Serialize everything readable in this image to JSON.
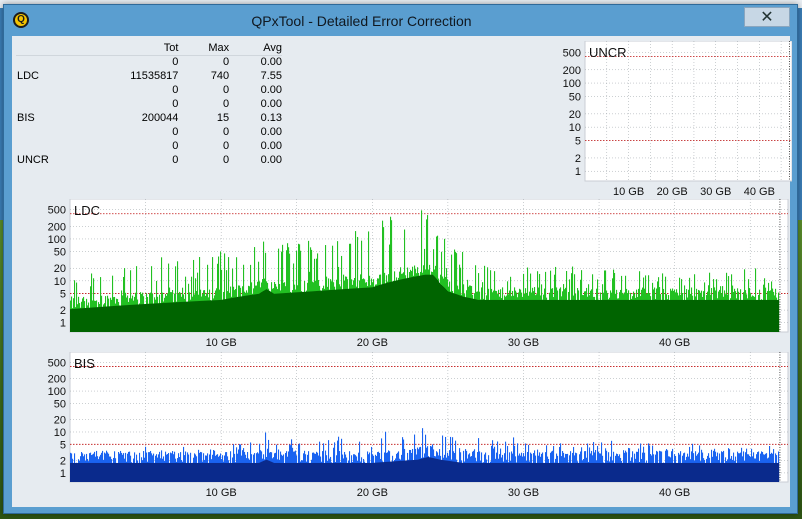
{
  "window": {
    "title": "QPxTool - Detailed Error Correction",
    "close_glyph": "✕",
    "app_icon_letter": "Q"
  },
  "colors": {
    "window_frame": "#5a9ed0",
    "client_bg": "#e6ebf0",
    "plot_bg": "#ffffff",
    "ldc_dark": "#006400",
    "ldc_light": "#22c022",
    "bis_dark": "#0a2a8c",
    "bis_light": "#1a63f0",
    "limit_line": "#c01010",
    "grid": "#9aa0a6"
  },
  "stats": {
    "headers": [
      "",
      "Tot",
      "Max",
      "Avg"
    ],
    "rows": [
      [
        "",
        "0",
        "0",
        "0.00"
      ],
      [
        "LDC",
        "11535817",
        "740",
        "7.55"
      ],
      [
        "",
        "0",
        "0",
        "0.00"
      ],
      [
        "",
        "0",
        "0",
        "0.00"
      ],
      [
        "BIS",
        "200044",
        "15",
        "0.13"
      ],
      [
        "",
        "0",
        "0",
        "0.00"
      ],
      [
        "",
        "0",
        "0",
        "0.00"
      ],
      [
        "UNCR",
        "0",
        "0",
        "0.00"
      ]
    ]
  },
  "chart_data": [
    {
      "type": "bar",
      "title": "UNCR",
      "y_scale": "log",
      "yticks": [
        "500",
        "200",
        "100",
        "50",
        "20",
        "10",
        "5",
        "2",
        "1"
      ],
      "xticks": [
        "10 GB",
        "20 GB",
        "30 GB",
        "40 GB"
      ],
      "xlim": [
        0,
        47.5
      ],
      "limit_lines": [
        400,
        5
      ],
      "grid": true,
      "series": [
        {
          "values": []
        }
      ]
    },
    {
      "type": "bar",
      "title": "LDC",
      "y_scale": "log",
      "yticks": [
        "500",
        "200",
        "100",
        "50",
        "20",
        "10",
        "5",
        "2",
        "1"
      ],
      "xticks": [
        "10 GB",
        "20 GB",
        "30 GB",
        "40 GB"
      ],
      "xlim": [
        0,
        47.5
      ],
      "data_end": 46.9,
      "limit_lines": [
        400,
        5
      ],
      "grid": true,
      "max_value": 740,
      "avg_value": 7.55,
      "profile": {
        "x": [
          0,
          5,
          10,
          12.5,
          13,
          13.5,
          16,
          20,
          23.5,
          24,
          24.5,
          25,
          26,
          27,
          28,
          30,
          35,
          40,
          46.9
        ],
        "upper": [
          15,
          25,
          40,
          70,
          160,
          70,
          90,
          150,
          500,
          300,
          110,
          60,
          40,
          30,
          22,
          18,
          18,
          16,
          16
        ],
        "typical": [
          3,
          4,
          5,
          7,
          9,
          7,
          8,
          10,
          20,
          20,
          12,
          8,
          6,
          5,
          5,
          5,
          5,
          5,
          5
        ]
      }
    },
    {
      "type": "bar",
      "title": "BIS",
      "y_scale": "log",
      "yticks": [
        "500",
        "200",
        "100",
        "50",
        "20",
        "10",
        "5",
        "2",
        "1"
      ],
      "xticks": [
        "10 GB",
        "20 GB",
        "30 GB",
        "40 GB"
      ],
      "xlim": [
        0,
        47.5
      ],
      "data_end": 46.9,
      "limit_lines": [
        400,
        5
      ],
      "grid": true,
      "max_value": 15,
      "avg_value": 0.13,
      "profile": {
        "x": [
          0,
          10,
          12.5,
          13,
          13.5,
          16,
          20,
          23,
          23.7,
          24.5,
          26,
          28,
          35,
          46.9
        ],
        "upper": [
          3,
          4,
          6,
          12,
          5,
          6,
          8,
          10,
          15,
          9,
          7,
          6,
          5,
          4
        ],
        "typical": [
          2.5,
          2.5,
          2.5,
          3,
          2.5,
          2.5,
          2.5,
          3,
          3.5,
          3,
          2.5,
          2.5,
          2.5,
          2.5
        ]
      }
    }
  ]
}
